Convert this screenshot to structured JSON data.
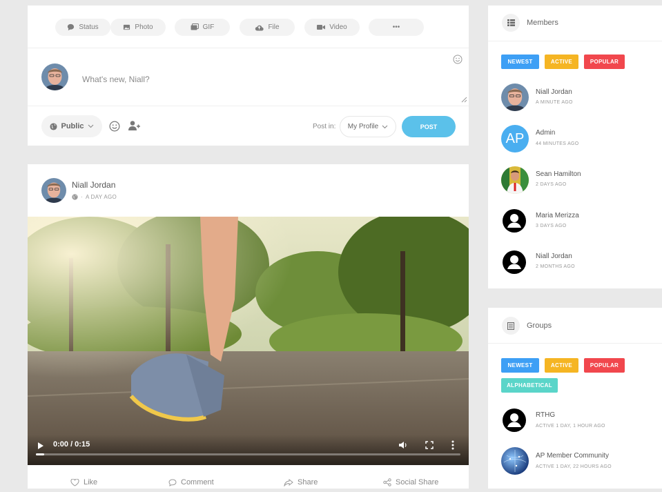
{
  "composer": {
    "types": [
      {
        "label": "Status",
        "icon": "speech-bubble-icon"
      },
      {
        "label": "Photo",
        "icon": "photo-icon"
      },
      {
        "label": "GIF",
        "icon": "gif-icon"
      },
      {
        "label": "File",
        "icon": "cloud-upload-icon"
      },
      {
        "label": "Video",
        "icon": "video-camera-icon"
      },
      {
        "label": "•••",
        "icon": "more-icon"
      }
    ],
    "placeholder": "What's new, Niall?",
    "privacy": "Public",
    "post_in_label": "Post in:",
    "post_in_value": "My Profile",
    "post_button": "POST"
  },
  "post": {
    "author": "Niall Jordan",
    "timestamp": "A DAY AGO",
    "video": {
      "time": "0:00 / 0:15",
      "progress_fraction": 0.02
    },
    "actions": [
      {
        "label": "Like",
        "icon": "heart-icon"
      },
      {
        "label": "Comment",
        "icon": "comment-icon"
      },
      {
        "label": "Share",
        "icon": "share-icon"
      },
      {
        "label": "Social Share",
        "icon": "social-share-icon"
      }
    ]
  },
  "members_widget": {
    "title": "Members",
    "tabs": [
      {
        "label": "NEWEST",
        "color": "#3d9ff5"
      },
      {
        "label": "ACTIVE",
        "color": "#f5b523"
      },
      {
        "label": "POPULAR",
        "color": "#f1474d"
      }
    ],
    "items": [
      {
        "name": "Niall Jordan",
        "time": "A MINUTE AGO"
      },
      {
        "name": "Admin",
        "time": "44 MINUTES AGO",
        "initials": "AP"
      },
      {
        "name": "Sean Hamilton",
        "time": "2 DAYS AGO"
      },
      {
        "name": "Maria Merizza",
        "time": "3 DAYS AGO"
      },
      {
        "name": "Niall Jordan",
        "time": "2 MONTHS AGO"
      }
    ]
  },
  "groups_widget": {
    "title": "Groups",
    "tabs": [
      {
        "label": "NEWEST",
        "color": "#3d9ff5"
      },
      {
        "label": "ACTIVE",
        "color": "#f5b523"
      },
      {
        "label": "POPULAR",
        "color": "#f1474d"
      },
      {
        "label": "ALPHABETICAL",
        "color": "#5ad5c9"
      }
    ],
    "items": [
      {
        "name": "RTHG",
        "time": "ACTIVE 1 DAY, 1 HOUR AGO"
      },
      {
        "name": "AP Member Community",
        "time": "ACTIVE 1 DAY, 22 HOURS AGO"
      }
    ]
  },
  "colors": {
    "accent": "#5bc1ea",
    "page_bg": "#e9e9e9"
  }
}
